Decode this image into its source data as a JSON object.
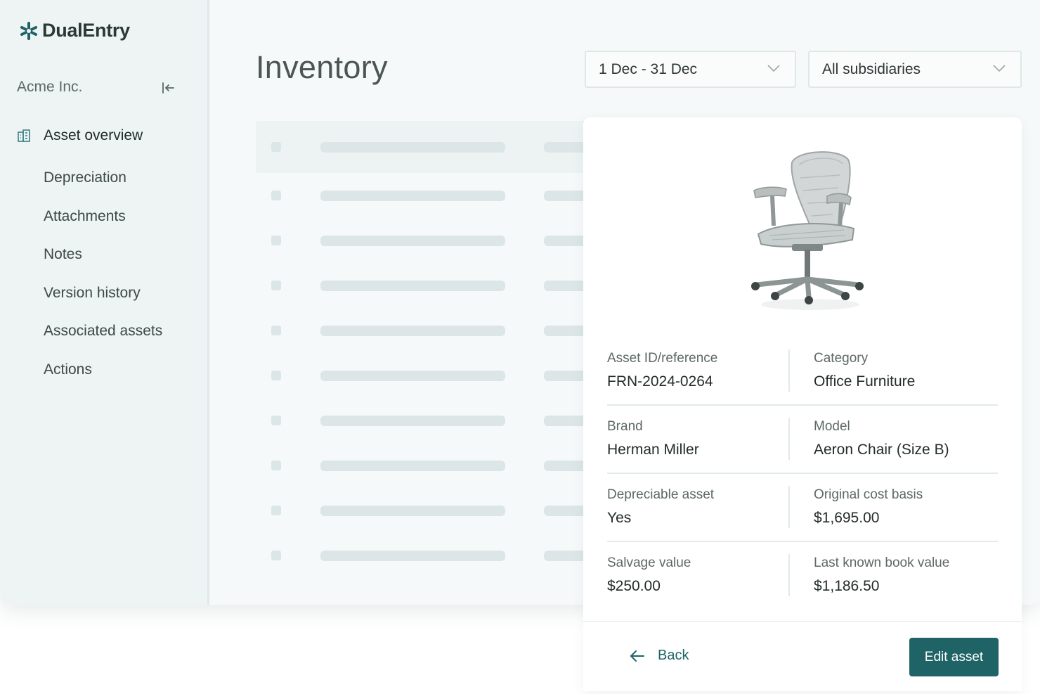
{
  "brand": {
    "name": "DualEntry",
    "accent": "#1f6366"
  },
  "sidebar": {
    "org_name": "Acme Inc.",
    "items": [
      {
        "label": "Asset overview",
        "active": true,
        "icon": "building-icon"
      },
      {
        "label": "Depreciation"
      },
      {
        "label": "Attachments"
      },
      {
        "label": "Notes"
      },
      {
        "label": "Version history"
      },
      {
        "label": "Associated assets"
      },
      {
        "label": "Actions"
      }
    ]
  },
  "header": {
    "title": "Inventory",
    "date_range": "1 Dec - 31 Dec",
    "subsidiary": "All subsidiaries"
  },
  "asset": {
    "image": "office-chair",
    "fields": [
      {
        "label": "Asset ID/reference",
        "value": "FRN-2024-0264"
      },
      {
        "label": "Category",
        "value": "Office Furniture"
      },
      {
        "label": "Brand",
        "value": "Herman Miller"
      },
      {
        "label": "Model",
        "value": "Aeron Chair (Size B)"
      },
      {
        "label": "Depreciable asset",
        "value": "Yes"
      },
      {
        "label": "Original cost basis",
        "value": "$1,695.00"
      },
      {
        "label": "Salvage value",
        "value": "$250.00"
      },
      {
        "label": "Last known book value",
        "value": "$1,186.50"
      }
    ]
  },
  "footer": {
    "back_label": "Back",
    "edit_label": "Edit asset"
  }
}
